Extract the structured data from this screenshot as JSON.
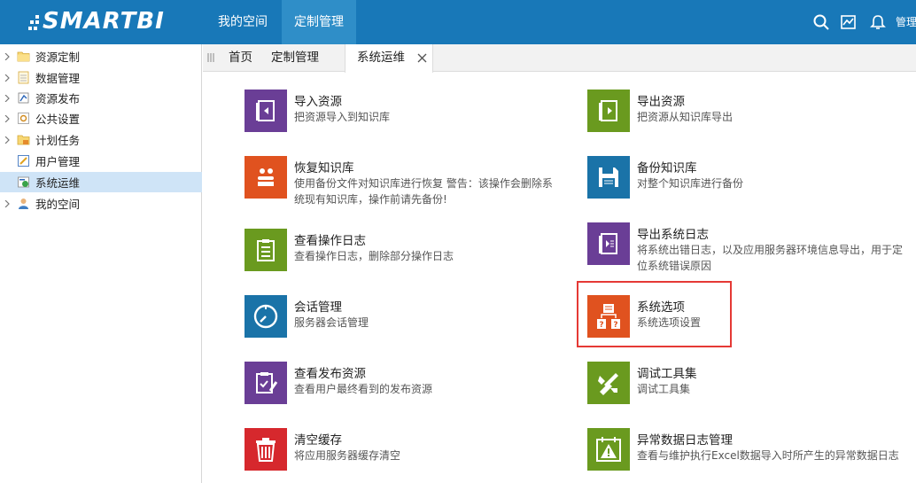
{
  "app": {
    "logo_text": "SMARTBI"
  },
  "topnav": {
    "items": [
      {
        "label": "我的空间"
      },
      {
        "label": "定制管理"
      }
    ],
    "user_label": "管理"
  },
  "sidebar": {
    "items": [
      {
        "label": "资源定制",
        "icon": "folder-icon"
      },
      {
        "label": "数据管理",
        "icon": "data-icon"
      },
      {
        "label": "资源发布",
        "icon": "publish-icon"
      },
      {
        "label": "公共设置",
        "icon": "settings-icon"
      },
      {
        "label": "计划任务",
        "icon": "task-icon"
      },
      {
        "label": "用户管理",
        "icon": "user-manage-icon"
      },
      {
        "label": "系统运维",
        "icon": "system-ops-icon"
      },
      {
        "label": "我的空间",
        "icon": "user-icon"
      }
    ]
  },
  "tabs": [
    {
      "label": "首页"
    },
    {
      "label": "定制管理"
    },
    {
      "label": "系统运维"
    }
  ],
  "tiles": [
    {
      "title": "导入资源",
      "desc": "把资源导入到知识库",
      "color": "#6a3e96"
    },
    {
      "title": "导出资源",
      "desc": "把资源从知识库导出",
      "color": "#6a9a1f"
    },
    {
      "title": "恢复知识库",
      "desc": "使用备份文件对知识库进行恢复 警告：该操作会删除系统现有知识库，操作前请先备份!",
      "color": "#e0521f"
    },
    {
      "title": "备份知识库",
      "desc": "对整个知识库进行备份",
      "color": "#1a73a8"
    },
    {
      "title": "查看操作日志",
      "desc": "查看操作日志，删除部分操作日志",
      "color": "#6a9a1f"
    },
    {
      "title": "导出系统日志",
      "desc": "将系统出错日志，以及应用服务器环境信息导出，用于定位系统错误原因",
      "color": "#6a3e96"
    },
    {
      "title": "会话管理",
      "desc": "服务器会话管理",
      "color": "#1a73a8"
    },
    {
      "title": "系统选项",
      "desc": "系统选项设置",
      "color": "#e0521f"
    },
    {
      "title": "查看发布资源",
      "desc": "查看用户最终看到的发布资源",
      "color": "#6a3e96"
    },
    {
      "title": "调试工具集",
      "desc": "调试工具集",
      "color": "#6a9a1f"
    },
    {
      "title": "清空缓存",
      "desc": "将应用服务器缓存清空",
      "color": "#d6282d"
    },
    {
      "title": "异常数据日志管理",
      "desc": "查看与维护执行Excel数据导入时所产生的异常数据日志",
      "color": "#6a9a1f"
    }
  ]
}
